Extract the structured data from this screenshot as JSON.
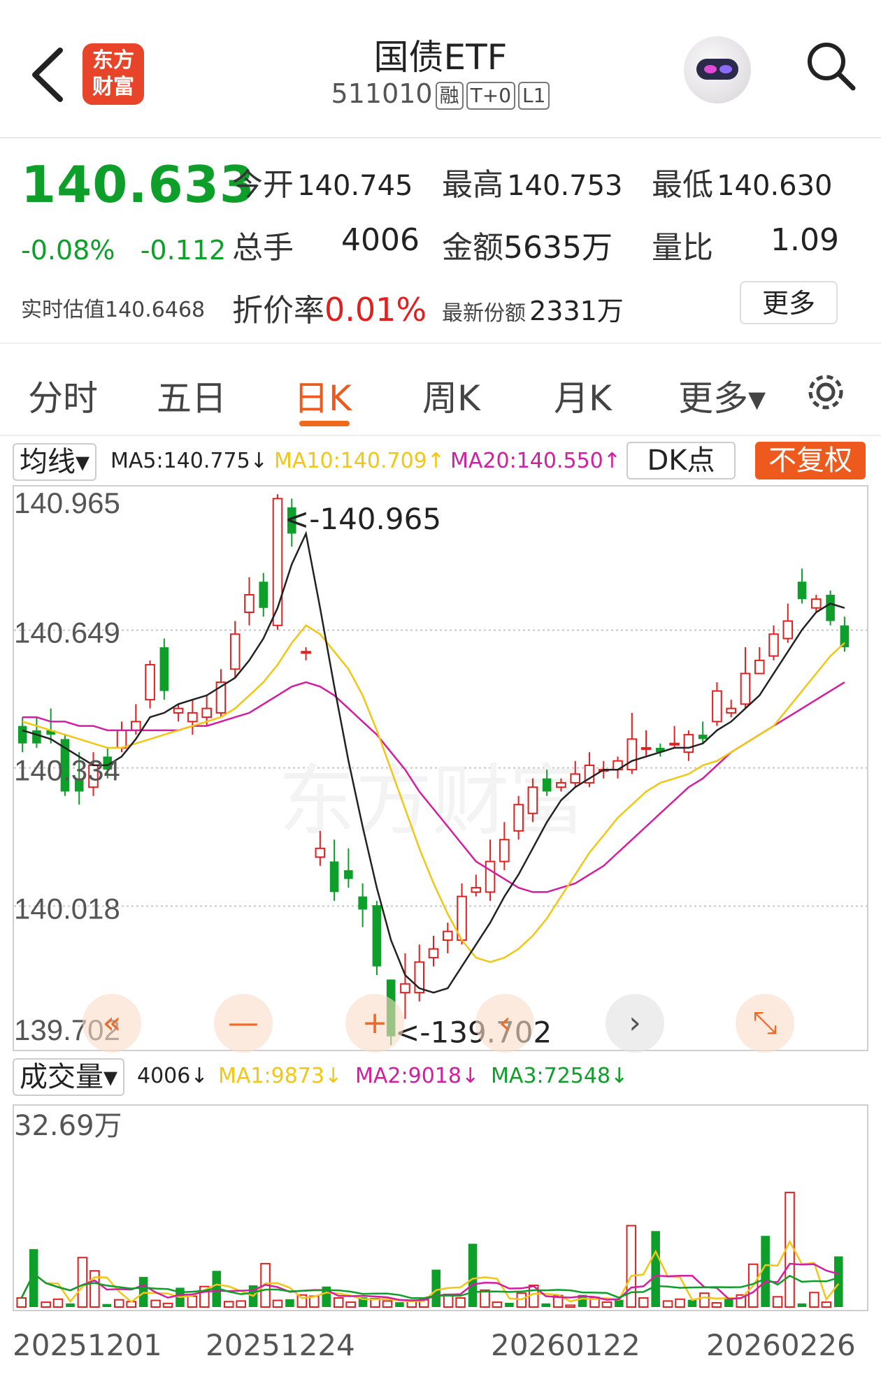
{
  "header": {
    "logo_line1": "东方",
    "logo_line2": "财富",
    "title": "国债ETF",
    "code": "511010",
    "tags": [
      "融",
      "T+0",
      "L1"
    ]
  },
  "quote": {
    "price": "140.633",
    "change_pct": "-0.08%",
    "change_abs": "-0.112",
    "est_label": "实时估值",
    "est_value": "140.6468",
    "open_label": "今开",
    "open": "140.745",
    "high_label": "最高",
    "high": "140.753",
    "low_label": "最低",
    "low": "140.630",
    "vol_label": "总手",
    "vol": "4006",
    "amount_label": "金额",
    "amount": "5635万",
    "ratio_label": "量比",
    "ratio": "1.09",
    "premium_label": "折价率",
    "premium": "0.01%",
    "shares_label": "最新份额",
    "shares": "2331万",
    "more": "更多"
  },
  "tabs": [
    "分时",
    "五日",
    "日K",
    "周K",
    "月K",
    "更多▾"
  ],
  "active_tab": "日K",
  "ma_legend": {
    "chip": "均线▾",
    "ma5": "MA5:140.775↓",
    "ma10": "MA10:140.709↑",
    "ma20": "MA20:140.550↑",
    "dk": "DK点",
    "adjust": "不复权"
  },
  "kline": {
    "y_labels": [
      "140.965",
      "140.649",
      "140.334",
      "140.018",
      "139.702"
    ],
    "max_annotation": "<-140.965",
    "min_annotation": "<-139.702",
    "watermark": "东方财富",
    "controls": [
      "«",
      "—",
      "+",
      "‹",
      "›",
      "⤡"
    ]
  },
  "volume": {
    "chip": "成交量▾",
    "vol": "4006↓",
    "ma1": "MA1:9873↓",
    "ma2": "MA2:9018↓",
    "ma3": "MA3:72548↓",
    "y_label": "32.69万"
  },
  "x_dates": [
    "20251201",
    "20251224",
    "20260122",
    "20260226"
  ],
  "colors": {
    "up": "#e02020",
    "down": "#0e9e2a",
    "ma5": "#222222",
    "ma10": "#f2c614",
    "ma20": "#d21ea0",
    "accent": "#ee5a1e"
  },
  "chart_data": {
    "type": "candlestick",
    "y_range": [
      139.702,
      140.965
    ],
    "candles": [
      [
        140.43,
        140.39,
        140.45,
        140.37
      ],
      [
        140.42,
        140.39,
        140.45,
        140.38
      ],
      [
        140.42,
        140.41,
        140.47,
        140.39
      ],
      [
        140.4,
        140.28,
        140.41,
        140.27
      ],
      [
        140.31,
        140.28,
        140.37,
        140.25
      ],
      [
        140.29,
        140.34,
        140.37,
        140.27
      ],
      [
        140.36,
        140.33,
        140.38,
        140.31
      ],
      [
        140.38,
        140.42,
        140.44,
        140.37
      ],
      [
        140.42,
        140.44,
        140.48,
        140.41
      ],
      [
        140.49,
        140.57,
        140.58,
        140.47
      ],
      [
        140.61,
        140.51,
        140.63,
        140.49
      ],
      [
        140.46,
        140.47,
        140.48,
        140.44
      ],
      [
        140.44,
        140.46,
        140.49,
        140.41
      ],
      [
        140.45,
        140.47,
        140.5,
        140.43
      ],
      [
        140.46,
        140.53,
        140.56,
        140.45
      ],
      [
        140.56,
        140.64,
        140.67,
        140.54
      ],
      [
        140.69,
        140.73,
        140.77,
        140.66
      ],
      [
        140.76,
        140.7,
        140.78,
        140.68
      ],
      [
        140.66,
        140.95,
        140.96,
        140.65
      ],
      [
        140.93,
        140.87,
        140.95,
        140.84
      ],
      [
        140.6,
        140.6,
        140.61,
        140.58
      ],
      [
        140.13,
        140.15,
        140.19,
        140.11
      ],
      [
        140.12,
        140.05,
        140.17,
        140.03
      ],
      [
        140.1,
        140.08,
        140.15,
        140.06
      ],
      [
        140.04,
        140.01,
        140.07,
        139.97
      ],
      [
        140.02,
        139.88,
        140.03,
        139.86
      ],
      [
        139.85,
        139.72,
        139.85,
        139.7
      ],
      [
        139.82,
        139.84,
        139.91,
        139.76
      ],
      [
        139.82,
        139.89,
        139.93,
        139.8
      ],
      [
        139.9,
        139.92,
        139.95,
        139.88
      ],
      [
        139.94,
        139.96,
        139.98,
        139.91
      ],
      [
        139.94,
        140.04,
        140.07,
        139.93
      ],
      [
        140.05,
        140.06,
        140.09,
        140.04
      ],
      [
        140.05,
        140.12,
        140.17,
        140.03
      ],
      [
        140.12,
        140.17,
        140.21,
        140.1
      ],
      [
        140.19,
        140.25,
        140.27,
        140.17
      ],
      [
        140.23,
        140.29,
        140.31,
        140.21
      ],
      [
        140.31,
        140.28,
        140.33,
        140.27
      ],
      [
        140.29,
        140.3,
        140.31,
        140.28
      ],
      [
        140.3,
        140.32,
        140.35,
        140.29
      ],
      [
        140.3,
        140.34,
        140.37,
        140.29
      ],
      [
        140.33,
        140.33,
        140.35,
        140.31
      ],
      [
        140.33,
        140.35,
        140.36,
        140.31
      ],
      [
        140.33,
        140.4,
        140.46,
        140.32
      ],
      [
        140.38,
        140.38,
        140.42,
        140.36
      ],
      [
        140.38,
        140.37,
        140.39,
        140.36
      ],
      [
        140.39,
        140.39,
        140.43,
        140.38
      ],
      [
        140.37,
        140.41,
        140.42,
        140.35
      ],
      [
        140.41,
        140.4,
        140.44,
        140.39
      ],
      [
        140.44,
        140.51,
        140.53,
        140.43
      ],
      [
        140.46,
        140.47,
        140.49,
        140.45
      ],
      [
        140.48,
        140.55,
        140.61,
        140.47
      ],
      [
        140.55,
        140.58,
        140.61,
        140.55
      ],
      [
        140.59,
        140.64,
        140.66,
        140.58
      ],
      [
        140.63,
        140.67,
        140.71,
        140.62
      ],
      [
        140.76,
        140.72,
        140.79,
        140.71
      ],
      [
        140.7,
        140.72,
        140.73,
        140.69
      ],
      [
        140.73,
        140.67,
        140.74,
        140.66
      ],
      [
        140.66,
        140.61,
        140.68,
        140.6
      ]
    ],
    "ma5": [
      140.42,
      140.41,
      140.4,
      140.38,
      140.36,
      140.34,
      140.34,
      140.36,
      140.4,
      140.45,
      140.46,
      140.48,
      140.49,
      140.5,
      140.52,
      140.54,
      140.58,
      140.63,
      140.7,
      140.8,
      140.87,
      140.7,
      140.52,
      140.35,
      140.2,
      140.06,
      139.94,
      139.86,
      139.83,
      139.82,
      139.83,
      139.88,
      139.93,
      139.98,
      140.04,
      140.09,
      140.15,
      140.21,
      140.26,
      140.29,
      140.31,
      140.33,
      140.33,
      140.35,
      140.36,
      140.37,
      140.38,
      140.38,
      140.39,
      140.42,
      140.44,
      140.47,
      140.5,
      140.55,
      140.6,
      140.65,
      140.69,
      140.71,
      140.7
    ],
    "ma10": [
      140.44,
      140.43,
      140.42,
      140.41,
      140.4,
      140.39,
      140.38,
      140.38,
      140.39,
      140.4,
      140.41,
      140.42,
      140.43,
      140.44,
      140.45,
      140.47,
      140.5,
      140.53,
      140.57,
      140.62,
      140.66,
      140.64,
      140.6,
      140.56,
      140.5,
      140.42,
      140.33,
      140.24,
      140.15,
      140.07,
      140.0,
      139.94,
      139.9,
      139.89,
      139.9,
      139.92,
      139.95,
      139.99,
      140.04,
      140.09,
      140.14,
      140.18,
      140.22,
      140.25,
      140.28,
      140.3,
      140.31,
      140.32,
      140.34,
      140.35,
      140.37,
      140.39,
      140.41,
      140.43,
      140.47,
      140.51,
      140.55,
      140.59,
      140.62
    ],
    "ma20": [
      140.45,
      140.45,
      140.44,
      140.44,
      140.43,
      140.43,
      140.42,
      140.42,
      140.42,
      140.42,
      140.42,
      140.42,
      140.43,
      140.43,
      140.44,
      140.45,
      140.46,
      140.48,
      140.5,
      140.52,
      140.53,
      140.52,
      140.5,
      140.47,
      140.44,
      140.41,
      140.37,
      140.33,
      140.28,
      140.24,
      140.2,
      140.16,
      140.12,
      140.1,
      140.08,
      140.06,
      140.05,
      140.05,
      140.06,
      140.07,
      140.09,
      140.11,
      140.14,
      140.17,
      140.2,
      140.23,
      140.26,
      140.29,
      140.31,
      140.34,
      140.37,
      140.39,
      140.41,
      140.43,
      140.45,
      140.47,
      140.49,
      140.51,
      140.53
    ],
    "volumes_wan": [
      1.5,
      9.6,
      0.8,
      1.3,
      0.6,
      8.2,
      6.0,
      0.5,
      1.2,
      0.9,
      5.0,
      1.1,
      0.6,
      3.2,
      1.8,
      3.4,
      6.0,
      0.9,
      1.0,
      3.6,
      7.2,
      1.1,
      1.3,
      2.0,
      1.8,
      3.4,
      1.5,
      0.8,
      1.6,
      1.4,
      1.0,
      0.8,
      1.0,
      1.2,
      6.2,
      2.1,
      1.5,
      10.5,
      2.8,
      0.8,
      0.7,
      2.3,
      3.6,
      0.6,
      1.9,
      0.3,
      2.0,
      1.6,
      0.8,
      1.2,
      13.5,
      1.5,
      12.6,
      1.0,
      1.3,
      1.2,
      2.3,
      0.7,
      1.5,
      2.0,
      7.1,
      11.8,
      1.7,
      19.0,
      0.6,
      2.4,
      0.8,
      8.4
    ],
    "volume_ymax_wan": 32.69
  }
}
